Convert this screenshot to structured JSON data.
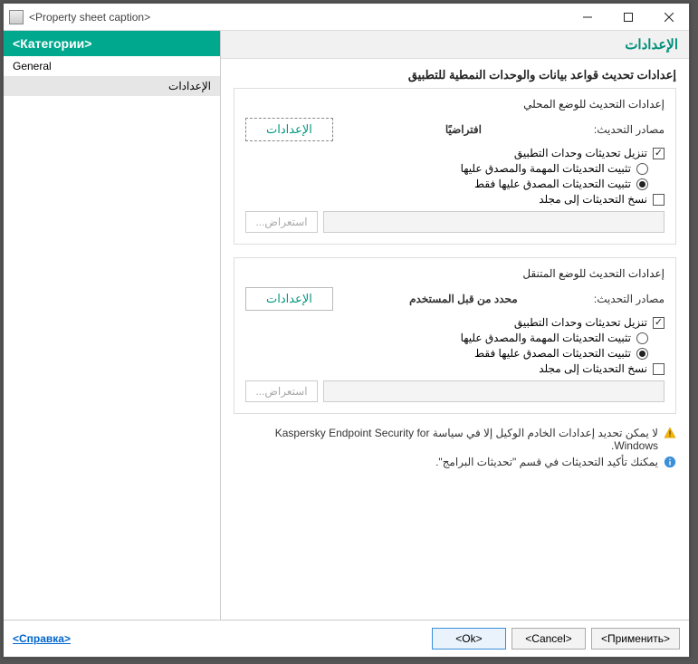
{
  "window": {
    "title": "<Property sheet caption>"
  },
  "sidebar": {
    "header": "<Категории>",
    "items": [
      {
        "label": "General"
      },
      {
        "label": "الإعدادات"
      }
    ]
  },
  "main": {
    "header": "الإعدادات",
    "section_title": "إعدادات تحديث قواعد بيانات والوحدات النمطية للتطبيق",
    "local": {
      "group_title": "إعدادات التحديث للوضع المحلي",
      "sources_label": "مصادر التحديث:",
      "sources_value": "افتراضيًا",
      "settings_btn": "الإعدادات",
      "download_modules": "تنزيل تحديثات وحدات التطبيق",
      "install_important": "تثبيت التحديثات المهمة والمصدق عليها",
      "install_approved_only": "تثبيت التحديثات المصدق عليها فقط",
      "copy_to_folder": "نسخ التحديثات إلى مجلد",
      "browse_btn": "استعراض..."
    },
    "mobile": {
      "group_title": "إعدادات التحديث للوضع المتنقل",
      "sources_label": "مصادر التحديث:",
      "sources_value": "محدد من قبل المستخدم",
      "settings_btn": "الإعدادات",
      "download_modules": "تنزيل تحديثات وحدات التطبيق",
      "install_important": "تثبيت التحديثات المهمة والمصدق عليها",
      "install_approved_only": "تثبيت التحديثات المصدق عليها فقط",
      "copy_to_folder": "نسخ التحديثات إلى مجلد",
      "browse_btn": "استعراض..."
    },
    "notes": {
      "warning": "لا يمكن تحديد إعدادات الخادم الوكيل إلا في سياسة Kaspersky Endpoint Security for Windows.",
      "info": "يمكنك تأكيد التحديثات في قسم \"تحديثات البرامج\"."
    }
  },
  "footer": {
    "help": "<Справка>",
    "ok": "<Ok>",
    "cancel": "<Cancel>",
    "apply": "<Применить>"
  }
}
